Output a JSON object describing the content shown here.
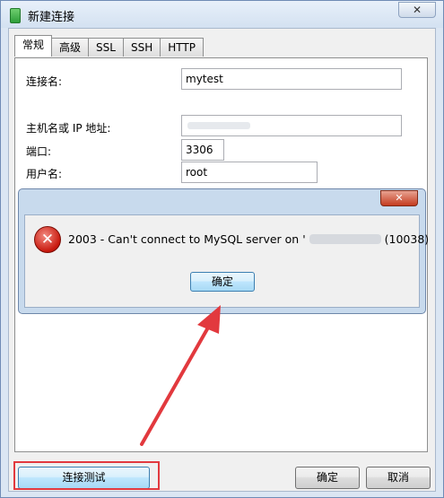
{
  "window": {
    "title": "新建连接",
    "close_glyph": "✕"
  },
  "tabs": [
    {
      "label": "常规",
      "active": true
    },
    {
      "label": "高级"
    },
    {
      "label": "SSL"
    },
    {
      "label": "SSH"
    },
    {
      "label": "HTTP"
    }
  ],
  "form": {
    "connection_name_label": "连接名:",
    "connection_name_value": "mytest",
    "host_label": "主机名或 IP 地址:",
    "host_value": "",
    "port_label": "端口:",
    "port_value": "3306",
    "user_label": "用户名:",
    "user_value": "root"
  },
  "buttons": {
    "test_connection": "连接测试",
    "ok": "确定",
    "cancel": "取消"
  },
  "error_dialog": {
    "close_glyph": "✕",
    "icon": "error-x-icon",
    "icon_glyph": "✕",
    "message_prefix": "2003 - Can't connect to MySQL server on '",
    "message_suffix": "(10038)",
    "ok_label": "确定"
  },
  "colors": {
    "highlight": "#e2393e",
    "error_icon": "#c8190e"
  }
}
